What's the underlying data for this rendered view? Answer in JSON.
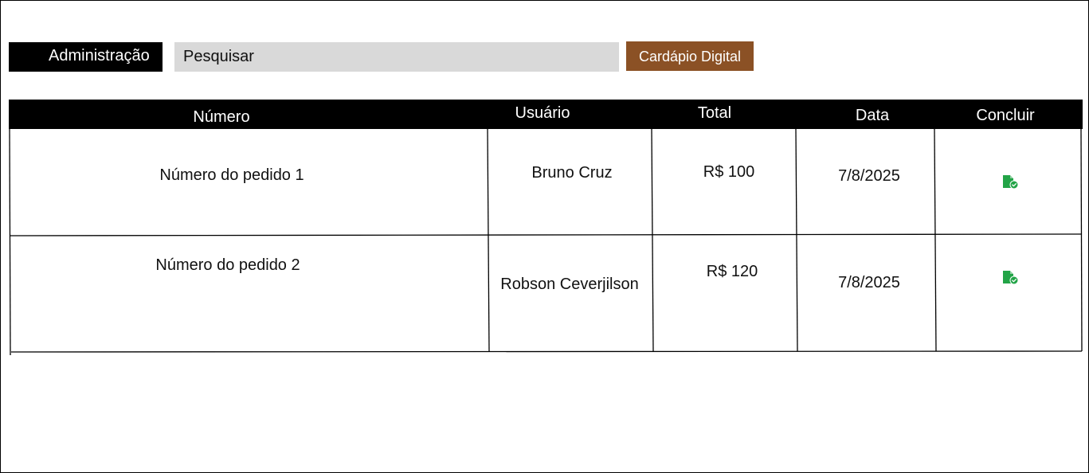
{
  "header": {
    "admin_label": "Administração",
    "search_placeholder": "Pesquisar",
    "menu_label": "Cardápio Digital"
  },
  "table": {
    "columns": [
      "Número",
      "Usuário",
      "Total",
      "Data",
      "Concluir"
    ],
    "rows": [
      {
        "numero": "Número do pedido 1",
        "usuario": "Bruno Cruz",
        "total": "R$ 100",
        "data": "7/8/2025",
        "concluir_icon": "file-check-icon"
      },
      {
        "numero": "Número do pedido 2",
        "usuario": "Robson Ceverjilson",
        "total": "R$ 120",
        "data": "7/8/2025",
        "concluir_icon": "file-check-icon"
      }
    ]
  },
  "colors": {
    "header_bg": "#000000",
    "search_bg": "#d9d9d9",
    "menu_bg": "#8b5125",
    "icon_green": "#22a447"
  }
}
